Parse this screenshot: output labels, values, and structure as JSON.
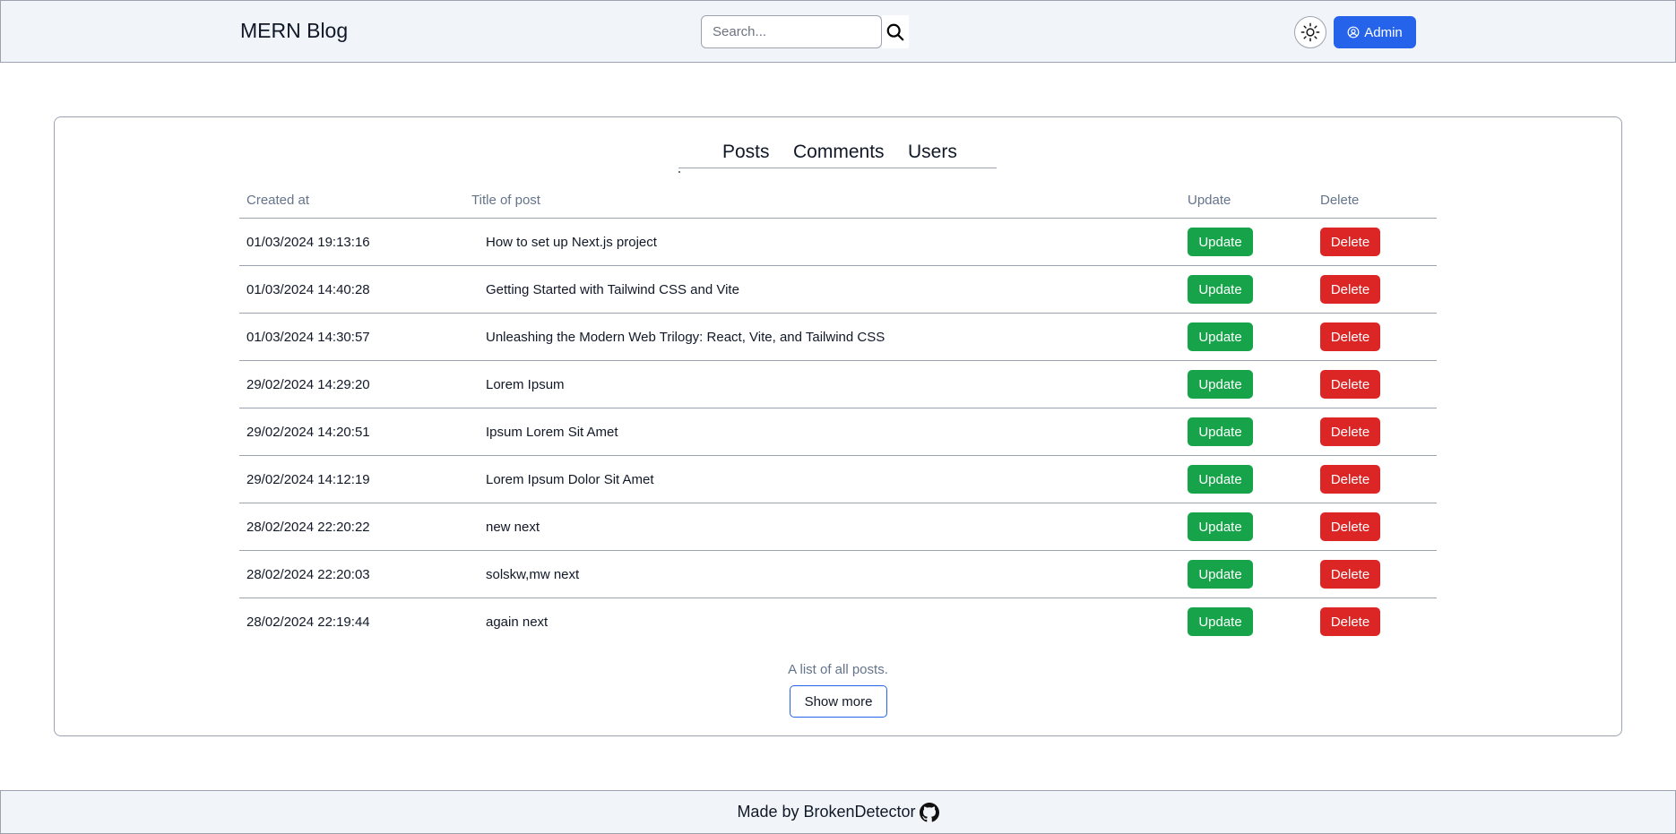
{
  "header": {
    "brand": "MERN Blog",
    "search": {
      "placeholder": "Search...",
      "value": ""
    },
    "admin_label": "Admin",
    "icons": {
      "search": "search-icon",
      "theme": "sun-icon",
      "admin": "user-circle-icon"
    }
  },
  "tabs": [
    {
      "label": "Posts"
    },
    {
      "label": "Comments"
    },
    {
      "label": "Users"
    }
  ],
  "table": {
    "headers": {
      "created_at": "Created at",
      "title": "Title of post",
      "update": "Update",
      "delete": "Delete"
    },
    "rows": [
      {
        "created_at": "01/03/2024 19:13:16",
        "title": "How to set up Next.js project",
        "update": "Update",
        "delete": "Delete"
      },
      {
        "created_at": "01/03/2024 14:40:28",
        "title": "Getting Started with Tailwind CSS and Vite",
        "update": "Update",
        "delete": "Delete"
      },
      {
        "created_at": "01/03/2024 14:30:57",
        "title": "Unleashing the Modern Web Trilogy: React, Vite, and Tailwind CSS",
        "update": "Update",
        "delete": "Delete"
      },
      {
        "created_at": "29/02/2024 14:29:20",
        "title": "Lorem Ipsum",
        "update": "Update",
        "delete": "Delete"
      },
      {
        "created_at": "29/02/2024 14:20:51",
        "title": "Ipsum Lorem Sit Amet",
        "update": "Update",
        "delete": "Delete"
      },
      {
        "created_at": "29/02/2024 14:12:19",
        "title": "Lorem Ipsum Dolor Sit Amet",
        "update": "Update",
        "delete": "Delete"
      },
      {
        "created_at": "28/02/2024 22:20:22",
        "title": "new next",
        "update": "Update",
        "delete": "Delete"
      },
      {
        "created_at": "28/02/2024 22:20:03",
        "title": "solskw,mw next",
        "update": "Update",
        "delete": "Delete"
      },
      {
        "created_at": "28/02/2024 22:19:44",
        "title": "again next",
        "update": "Update",
        "delete": "Delete"
      }
    ],
    "caption": "A list of all posts.",
    "show_more": "Show more"
  },
  "footer": {
    "text": "Made by BrokenDetector",
    "icon": "github-icon"
  },
  "colors": {
    "header_bg": "#f1f5f9",
    "primary": "#2563eb",
    "update": "#16a34a",
    "delete": "#dc2626",
    "muted_text": "#64748b"
  }
}
